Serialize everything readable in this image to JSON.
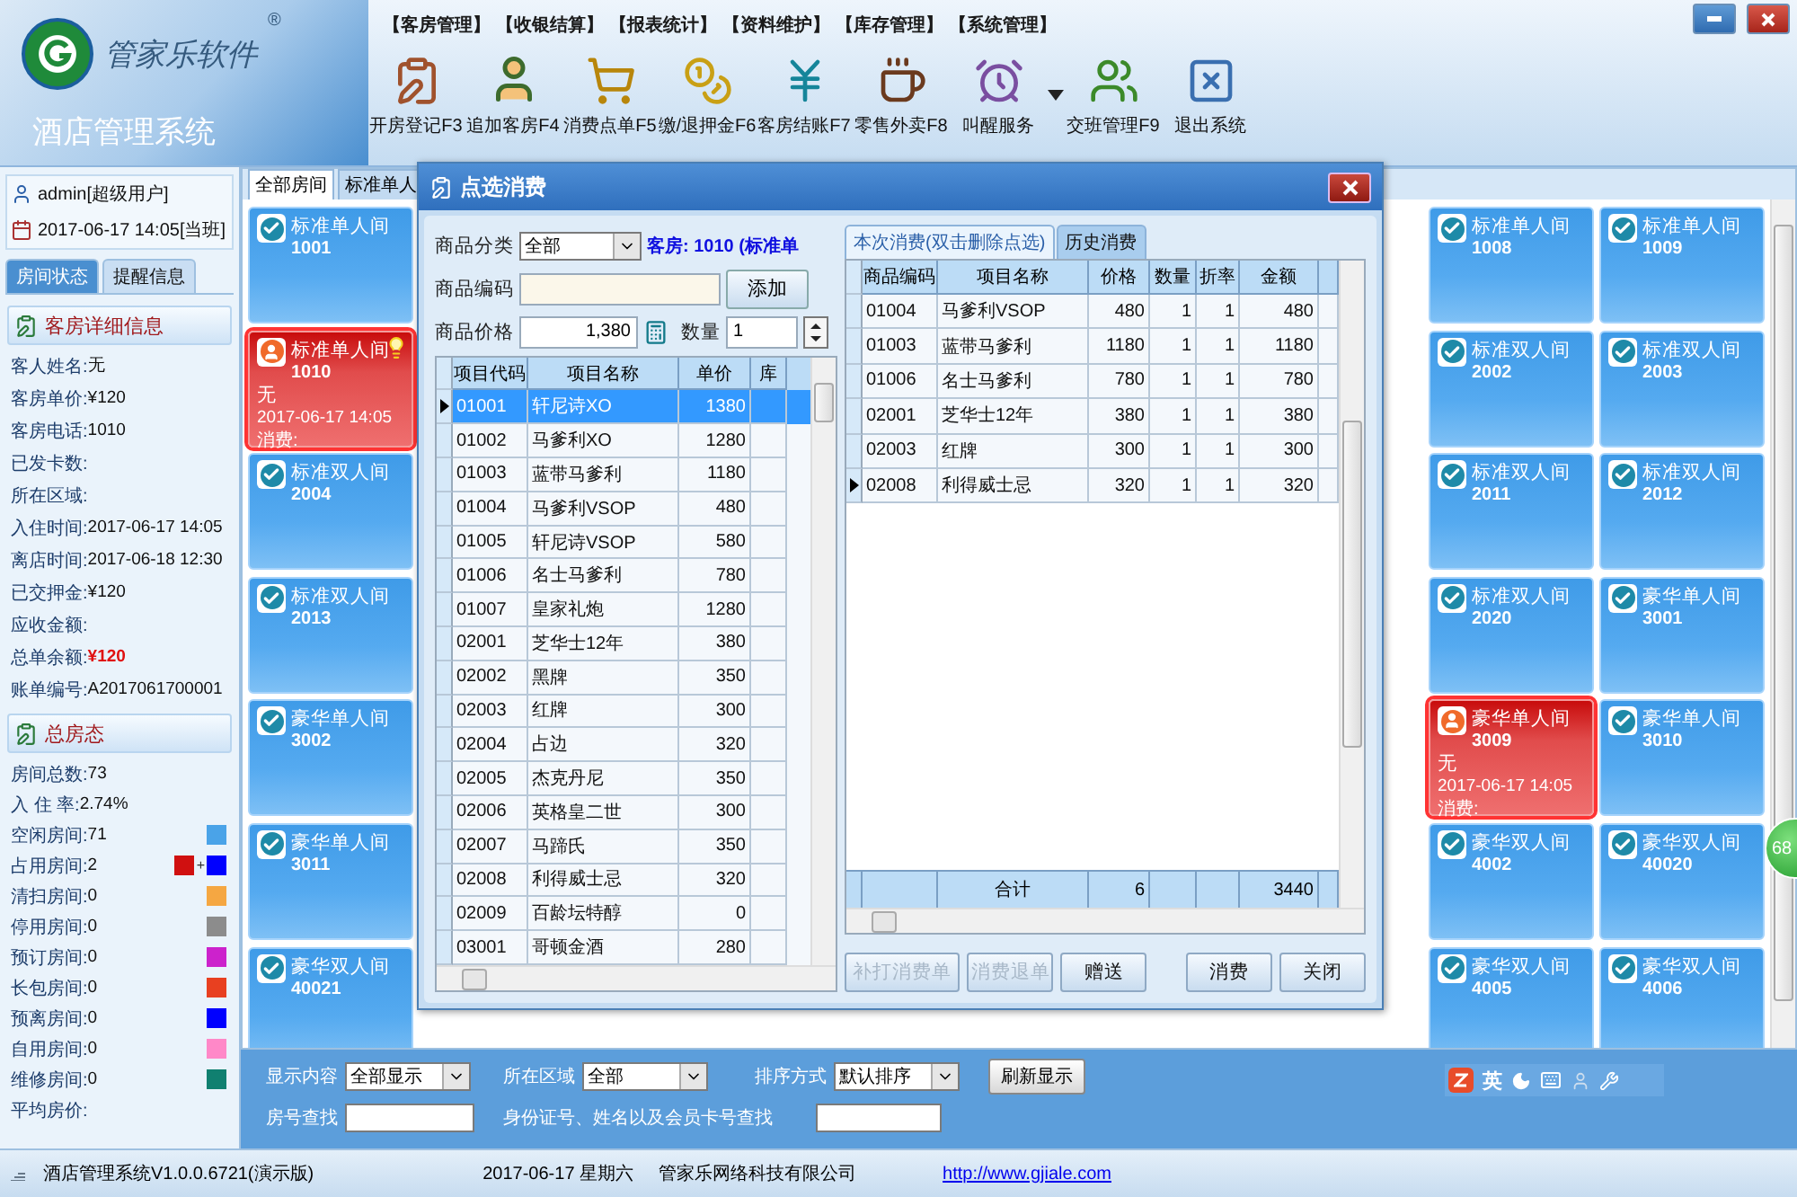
{
  "window": {
    "brand": "管家乐软件",
    "registered_mark": "®",
    "title": "酒店管理系统"
  },
  "menu": [
    "【客房管理】",
    "【收银结算】",
    "【报表统计】",
    "【资料维护】",
    "【库存管理】",
    "【系统管理】"
  ],
  "toolbar": [
    {
      "label": "开房登记F3",
      "has_menu": false
    },
    {
      "label": "追加客房F4",
      "has_menu": false
    },
    {
      "label": "消费点单F5",
      "has_menu": false
    },
    {
      "label": "缴/退押金F6",
      "has_menu": false
    },
    {
      "label": "客房结账F7",
      "has_menu": false
    },
    {
      "label": "零售外卖F8",
      "has_menu": false
    },
    {
      "label": "叫醒服务",
      "has_menu": true
    },
    {
      "label": "交班管理F9",
      "has_menu": false
    },
    {
      "label": "退出系统",
      "has_menu": false
    }
  ],
  "sidebar": {
    "user": "admin[超级用户]",
    "shift": "2017-06-17 14:05[当班]",
    "tabs": [
      {
        "label": "房间状态",
        "selected": true
      },
      {
        "label": "提醒信息",
        "selected": false
      }
    ],
    "detail_title": "客房详细信息",
    "details": [
      {
        "label": "客人姓名:",
        "value": "无",
        "emphasis": false
      },
      {
        "label": "客房单价:",
        "value": "¥120",
        "emphasis": false
      },
      {
        "label": "客房电话:",
        "value": "1010",
        "emphasis": false
      },
      {
        "label": "已发卡数:"
      },
      {
        "label": "所在区域:"
      },
      {
        "label": "入住时间:",
        "value": "2017-06-17 14:05",
        "emphasis": false
      },
      {
        "label": "离店时间:",
        "value": "2017-06-18 12:30",
        "emphasis": false
      },
      {
        "label": "已交押金:",
        "value": "¥120",
        "emphasis": false
      },
      {
        "label": "应收金额:"
      },
      {
        "label": "总单余额:",
        "value": "¥120",
        "emphasis": true
      },
      {
        "label": "账单编号:",
        "value": "A2017061700001",
        "emphasis": false
      }
    ],
    "summary_title": "总房态",
    "summary": [
      {
        "label": "房间总数:",
        "value": "73"
      },
      {
        "label": "入 住 率:",
        "value": "2.74%"
      },
      {
        "label": "空闲房间:",
        "value": "71",
        "swatches": [
          {
            "color": "#4aa3e8"
          }
        ]
      },
      {
        "label": "占用房间:",
        "value": "2",
        "joiner": "+",
        "swatches": [
          {
            "color": "#d01010"
          },
          {
            "color": "#0000ff"
          }
        ]
      },
      {
        "label": "清扫房间:",
        "value": "0",
        "swatches": [
          {
            "color": "#f5a742"
          }
        ]
      },
      {
        "label": "停用房间:",
        "value": "0",
        "swatches": [
          {
            "color": "#8c8c8c"
          }
        ]
      },
      {
        "label": "预订房间:",
        "value": "0",
        "swatches": [
          {
            "color": "#cc22cc"
          }
        ]
      },
      {
        "label": "长包房间:",
        "value": "0",
        "swatches": [
          {
            "color": "#e84020"
          }
        ]
      },
      {
        "label": "预离房间:",
        "value": "0",
        "swatches": [
          {
            "color": "#0000ff"
          }
        ]
      },
      {
        "label": "自用房间:",
        "value": "0",
        "swatches": [
          {
            "color": "#ff88c8"
          }
        ]
      },
      {
        "label": "维修房间:",
        "value": "0",
        "swatches": [
          {
            "color": "#108070"
          }
        ]
      },
      {
        "label": "平均房价:"
      }
    ]
  },
  "room_tabs": [
    {
      "label": "全部房间",
      "selected": true
    },
    {
      "label": "标准单人",
      "selected": false
    }
  ],
  "rooms": [
    {
      "type": "标准单人间",
      "number": "1001",
      "occupied": false,
      "reminder": false
    },
    {
      "type": "标准单人间",
      "number": "1008",
      "occupied": false,
      "reminder": false
    },
    {
      "type": "标准单人间",
      "number": "1009",
      "occupied": false,
      "reminder": false
    },
    {
      "type": "标准单人间",
      "number": "1010",
      "occupied": true,
      "reminder": true,
      "guest": "无",
      "time": "2017-06-17 14:05",
      "consumption": "消费:"
    },
    {
      "type": "标准双人间",
      "number": "2002",
      "occupied": false,
      "reminder": false
    },
    {
      "type": "标准双人间",
      "number": "2003",
      "occupied": false,
      "reminder": false
    },
    {
      "type": "标准双人间",
      "number": "2004",
      "occupied": false,
      "reminder": false
    },
    {
      "type": "标准双人间",
      "number": "2011",
      "occupied": false,
      "reminder": false
    },
    {
      "type": "标准双人间",
      "number": "2012",
      "occupied": false,
      "reminder": false
    },
    {
      "type": "标准双人间",
      "number": "2013",
      "occupied": false,
      "reminder": false
    },
    {
      "type": "标准双人间",
      "number": "2020",
      "occupied": false,
      "reminder": false
    },
    {
      "type": "豪华单人间",
      "number": "3001",
      "occupied": false,
      "reminder": false
    },
    {
      "type": "豪华单人间",
      "number": "3002",
      "occupied": false,
      "reminder": false
    },
    {
      "type": "豪华单人间",
      "number": "3009",
      "occupied": true,
      "reminder": false,
      "guest": "无",
      "time": "2017-06-17 14:05",
      "consumption": "消费:"
    },
    {
      "type": "豪华单人间",
      "number": "3010",
      "occupied": false,
      "reminder": false
    },
    {
      "type": "豪华单人间",
      "number": "3011",
      "occupied": false,
      "reminder": false
    },
    {
      "type": "豪华双人间",
      "number": "4002",
      "occupied": false,
      "reminder": false
    },
    {
      "type": "豪华双人间",
      "number": "40020",
      "occupied": false,
      "reminder": false
    },
    {
      "type": "豪华双人间",
      "number": "40021",
      "occupied": false,
      "reminder": false
    },
    {
      "type": "豪华双人间",
      "number": "4005",
      "occupied": false,
      "reminder": false
    },
    {
      "type": "豪华双人间",
      "number": "4006",
      "occupied": false,
      "reminder": false
    }
  ],
  "floating_badge": "68",
  "dialog": {
    "title": "点选消费",
    "category_label": "商品分类",
    "category": "全部",
    "room_info": "客房: 1010 (标准单",
    "code_label": "商品编码",
    "add_button": "添加",
    "price_label": "商品价格",
    "price": "1,380",
    "qty_label": "数量",
    "qty": "1",
    "product_columns": [
      "项目代码",
      "项目名称",
      "单价",
      "库"
    ],
    "products": [
      {
        "code": "01001",
        "name": "轩尼诗XO",
        "price": "1380",
        "selected": true
      },
      {
        "code": "01002",
        "name": "马爹利XO",
        "price": "1280",
        "selected": false
      },
      {
        "code": "01003",
        "name": "蓝带马爹利",
        "price": "1180",
        "selected": false
      },
      {
        "code": "01004",
        "name": "马爹利VSOP",
        "price": "480",
        "selected": false
      },
      {
        "code": "01005",
        "name": "轩尼诗VSOP",
        "price": "580",
        "selected": false
      },
      {
        "code": "01006",
        "name": "名士马爹利",
        "price": "780",
        "selected": false
      },
      {
        "code": "01007",
        "name": "皇家礼炮",
        "price": "1280",
        "selected": false
      },
      {
        "code": "02001",
        "name": "芝华士12年",
        "price": "380",
        "selected": false
      },
      {
        "code": "02002",
        "name": "黑牌",
        "price": "350",
        "selected": false
      },
      {
        "code": "02003",
        "name": "红牌",
        "price": "300",
        "selected": false
      },
      {
        "code": "02004",
        "name": "占边",
        "price": "320",
        "selected": false
      },
      {
        "code": "02005",
        "name": "杰克丹尼",
        "price": "350",
        "selected": false
      },
      {
        "code": "02006",
        "name": "英格皇二世",
        "price": "300",
        "selected": false
      },
      {
        "code": "02007",
        "name": "马蹄氏",
        "price": "350",
        "selected": false
      },
      {
        "code": "02008",
        "name": "利得威士忌",
        "price": "320",
        "selected": false
      },
      {
        "code": "02009",
        "name": "百龄坛特醇",
        "price": "0",
        "selected": false
      },
      {
        "code": "03001",
        "name": "哥顿金酒",
        "price": "280",
        "selected": false
      }
    ],
    "order_tabs": [
      {
        "label": "本次消费(双击删除点选)",
        "selected": true
      },
      {
        "label": "历史消费",
        "selected": false
      }
    ],
    "order_columns": [
      "商品编码",
      "项目名称",
      "价格",
      "数量",
      "折率",
      "金额"
    ],
    "orders": [
      {
        "code": "01004",
        "name": "马爹利VSOP",
        "price": "480",
        "qty": "1",
        "rate": "1",
        "amount": "480",
        "current": false
      },
      {
        "code": "01003",
        "name": "蓝带马爹利",
        "price": "1180",
        "qty": "1",
        "rate": "1",
        "amount": "1180",
        "current": false
      },
      {
        "code": "01006",
        "name": "名士马爹利",
        "price": "780",
        "qty": "1",
        "rate": "1",
        "amount": "780",
        "current": false
      },
      {
        "code": "02001",
        "name": "芝华士12年",
        "price": "380",
        "qty": "1",
        "rate": "1",
        "amount": "380",
        "current": false
      },
      {
        "code": "02003",
        "name": "红牌",
        "price": "300",
        "qty": "1",
        "rate": "1",
        "amount": "300",
        "current": false
      },
      {
        "code": "02008",
        "name": "利得威士忌",
        "price": "320",
        "qty": "1",
        "rate": "1",
        "amount": "320",
        "current": true
      }
    ],
    "total": {
      "label": "合计",
      "qty": "6",
      "amount": "3440"
    },
    "buttons": [
      {
        "label": "补打消费单",
        "disabled": true
      },
      {
        "label": "消费退单",
        "disabled": true
      },
      {
        "label": "赠送",
        "disabled": false
      },
      {
        "label": "消费",
        "disabled": false
      },
      {
        "label": "关闭",
        "disabled": false
      }
    ]
  },
  "filters": {
    "display_label": "显示内容",
    "display": "全部显示",
    "area_label": "所在区域",
    "area": "全部",
    "sort_label": "排序方式",
    "sort": "默认排序",
    "refresh": "刷新显示",
    "room_search_label": "房号查找",
    "id_search_label": "身份证号、姓名以及会员卡号查找",
    "ime_label": "英"
  },
  "status_bar": {
    "version": "酒店管理系统V1.0.0.6721(演示版)",
    "date": "2017-06-17 星期六",
    "company": "管家乐网络科技有限公司",
    "url": "http://www.gjiale.com"
  }
}
